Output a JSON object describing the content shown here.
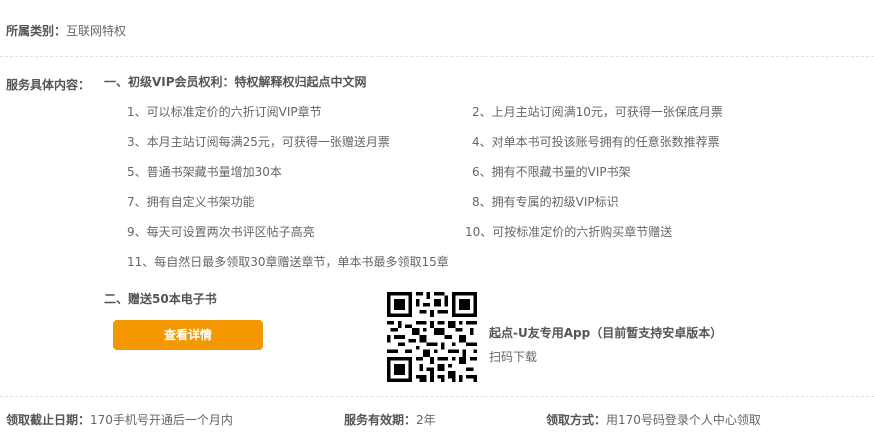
{
  "category": {
    "label": "所属类别：",
    "value": "互联网特权"
  },
  "service": {
    "label": "服务具体内容：",
    "section1_title": "一、初级VIP会员权利：特权解释权归起点中文网",
    "benefits": [
      "1、可以标准定价的六折订阅VIP章节",
      "2、上月主站订阅满10元，可获得一张保底月票",
      "3、本月主站订阅每满25元，可获得一张赠送月票",
      "4、对单本书可投该账号拥有的任意张数推荐票",
      "5、普通书架藏书量增加30本",
      "6、拥有不限藏书量的VIP书架",
      "7、拥有自定义书架功能",
      "8、拥有专属的初级VIP标识",
      "9、每天可设置两次书评区帖子高亮",
      "10、可按标准定价的六折购买章节赠送",
      "11、每自然日最多领取30章赠送章节，单本书最多领取15章"
    ],
    "section2_title": "二、赠送50本电子书",
    "detail_button": "查看详情",
    "app_title": "起点-U友专用App（目前暂支持安卓版本）",
    "app_subtitle": "扫码下载"
  },
  "bottom": {
    "deadline_label": "领取截止日期：",
    "deadline_value": "170手机号开通后一个月内",
    "validity_label": "服务有效期：",
    "validity_value": "2年",
    "method_label": "领取方式：",
    "method_value": "用170号码登录个人中心领取"
  },
  "colors": {
    "button": "#f39800",
    "text": "#555555",
    "divider": "#e2e2e2"
  },
  "icons": {
    "qr": "qr-code-icon"
  }
}
